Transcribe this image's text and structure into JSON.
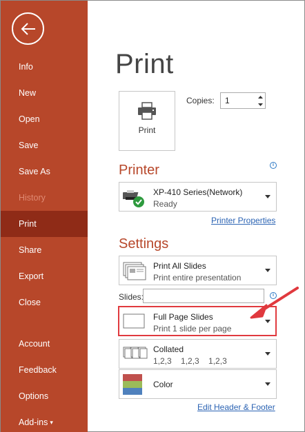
{
  "sidebar": {
    "items": [
      {
        "label": "Info"
      },
      {
        "label": "New"
      },
      {
        "label": "Open"
      },
      {
        "label": "Save"
      },
      {
        "label": "Save As"
      },
      {
        "label": "History"
      },
      {
        "label": "Print"
      },
      {
        "label": "Share"
      },
      {
        "label": "Export"
      },
      {
        "label": "Close"
      },
      {
        "label": "Account"
      },
      {
        "label": "Feedback"
      },
      {
        "label": "Options"
      },
      {
        "label": "Add-ins"
      }
    ]
  },
  "main": {
    "title": "Print",
    "print_button": "Print",
    "copies_label": "Copies:",
    "copies_value": "1"
  },
  "printer": {
    "heading": "Printer",
    "name": "XP-410 Series(Network)",
    "status": "Ready",
    "properties_link": "Printer Properties"
  },
  "settings": {
    "heading": "Settings",
    "print_slides": {
      "title": "Print All Slides",
      "subtitle": "Print entire presentation"
    },
    "slides_label": "Slides:",
    "slides_value": "",
    "layout": {
      "title": "Full Page Slides",
      "subtitle": "Print 1 slide per page"
    },
    "collation": {
      "title": "Collated",
      "subtitle": "1,2,3    1,2,3    1,2,3"
    },
    "color": {
      "title": "Color"
    },
    "header_footer_link": "Edit Header & Footer"
  },
  "colors": {
    "accent": "#b7472a",
    "sidebar_active": "#8f2b17",
    "link": "#2b63b3",
    "annotation": "#e0393e"
  }
}
